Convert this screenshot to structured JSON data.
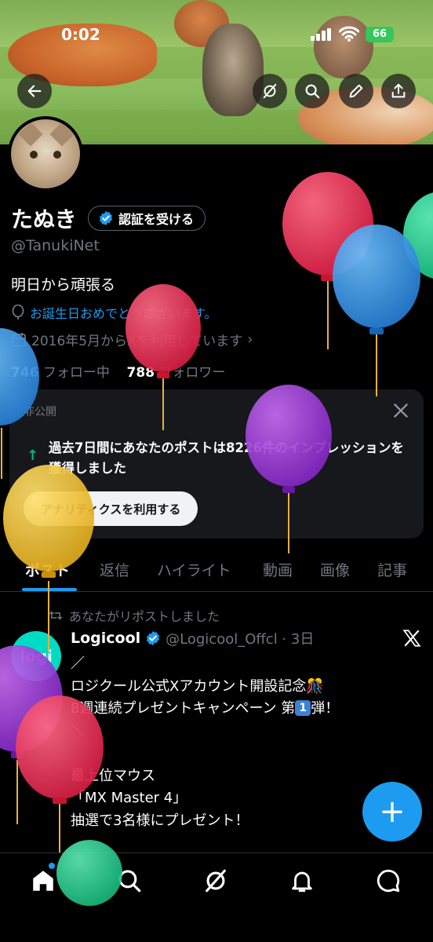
{
  "status_bar": {
    "time": "0:02",
    "battery": "66"
  },
  "profile": {
    "name": "たぬき",
    "verify_button": "認証を受ける",
    "handle": "@TanukiNet",
    "bio": "明日から頑張る",
    "birthday_text": "お誕生日おめでとうございます。",
    "joined_text": "2016年5月からXを利用しています",
    "following_count": "746",
    "following_label": "フォロー中",
    "followers_count": "788",
    "followers_label": "フォロワー"
  },
  "card": {
    "label": "非公開",
    "text": "過去7日間にあなたのポストは8226件のインプレッションを獲得しました",
    "button": "アナリティクスを利用する"
  },
  "tabs": [
    "ポスト",
    "返信",
    "ハイライト",
    "動画",
    "画像",
    "記事"
  ],
  "post": {
    "repost_label": "あなたがリポストしました",
    "avatar_text": "logi",
    "name": "Logicool",
    "meta": "@Logicool_Offcl · 3日",
    "lines": [
      "／",
      "ロジクール公式Xアカウント開設記念🎊",
      "8週連続プレゼントキャンペーン 第",
      "＼",
      "",
      "最上位マウス",
      "「MX Master 4」",
      "抽選で3名様にプレゼント！"
    ],
    "line3_badge": "1",
    "line3_suffix": "弾！"
  },
  "fab_label": "+",
  "icons": {
    "back": "back-arrow-icon",
    "grok": "grok-icon",
    "search": "search-icon",
    "edit": "edit-icon",
    "share": "share-icon",
    "home": "home-icon",
    "explore": "search-icon",
    "notifications": "bell-icon",
    "messages": "message-icon"
  },
  "colors": {
    "accent": "#1d9bf0",
    "balloon_red": "#e8264a",
    "balloon_blue": "#2a8fe0",
    "balloon_purple": "#9b2fd6",
    "balloon_yellow": "#f2c12a",
    "balloon_green": "#19c98a"
  }
}
